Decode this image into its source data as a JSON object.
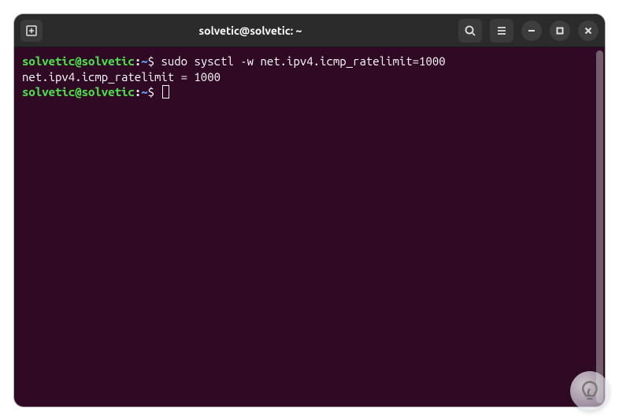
{
  "titlebar": {
    "title": "solvetic@solvetic: ~"
  },
  "terminal": {
    "lines": [
      {
        "prompt_user": "solvetic@solvetic",
        "prompt_separator": ":",
        "prompt_path": "~",
        "prompt_dollar": "$ ",
        "command": "sudo sysctl -w net.ipv4.icmp_ratelimit=1000"
      },
      {
        "output": "net.ipv4.icmp_ratelimit = 1000"
      },
      {
        "prompt_user": "solvetic@solvetic",
        "prompt_separator": ":",
        "prompt_path": "~",
        "prompt_dollar": "$ ",
        "command": ""
      }
    ]
  },
  "colors": {
    "terminal_bg": "#300a24",
    "titlebar_bg": "#2b2b2b",
    "prompt_user": "#4be04b",
    "prompt_path": "#5f9ff5",
    "text": "#ffffff"
  }
}
